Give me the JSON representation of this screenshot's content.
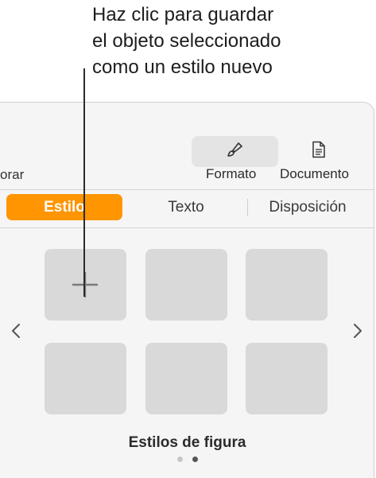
{
  "callout": {
    "lines": [
      "Haz clic para guardar",
      "el objeto seleccionado",
      "como un estilo nuevo"
    ]
  },
  "toolbar": {
    "prev_label": "orar",
    "format_label": "Formato",
    "document_label": "Documento",
    "format_icon": "paintbrush-icon",
    "document_icon": "document-icon"
  },
  "tabs": [
    {
      "label": "Estilo",
      "selected": true
    },
    {
      "label": "Texto",
      "selected": false
    },
    {
      "label": "Disposición",
      "selected": false
    }
  ],
  "styles": {
    "add_icon": "plus-icon",
    "section_label": "Estilos de figura",
    "page_count": 2,
    "current_page": 2
  },
  "colors": {
    "accent": "#ff9500",
    "tile": "#d9d9d9",
    "panel": "#f5f5f5"
  }
}
